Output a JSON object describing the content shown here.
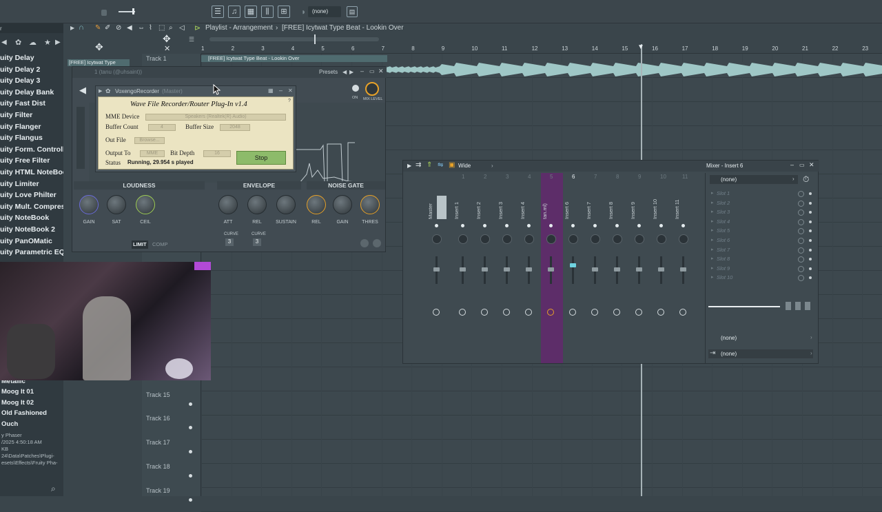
{
  "toolbar": {
    "pattern_selector": "(none)"
  },
  "browser": {
    "items": [
      "uity Delay",
      "uity Delay 2",
      "uity Delay 3",
      "uity Delay Bank",
      "uity Fast Dist",
      "uity Filter",
      "uity Flanger",
      "uity Flangus",
      "uity Form. Controller",
      "uity Free Filter",
      "uity HTML NoteBook",
      "uity Limiter",
      "uity Love Philter",
      "uity Mult. Compressor",
      "uity NoteBook",
      "uity NoteBook 2",
      "uity PanOMatic",
      "uity Parametric EQ"
    ],
    "lower_items": [
      "Metallic",
      "Moog It 01",
      "Moog It 02",
      "Old Fashioned",
      "Ouch"
    ],
    "info": {
      "name": "y Phaser",
      "date": "/2025 4:50:18 AM",
      "size": "KB",
      "path1": "24\\Data\\Patches\\Plugi-",
      "path2": "esets\\Effects\\Fruity Pha-"
    }
  },
  "playlist": {
    "title": "Playlist - Arrangement",
    "breadcrumb": "[FREE] Icytwat Type Beat - Lookin Over",
    "clip_name": "[FREE] Icytwat Type Beat - Lookin Over",
    "clip_label_left": "[FREE] Icytwat Type",
    "ruler": [
      "1",
      "2",
      "3",
      "4",
      "5",
      "6",
      "7",
      "8",
      "9",
      "10",
      "11",
      "12",
      "13",
      "14",
      "15",
      "16",
      "17",
      "18",
      "19",
      "20",
      "21",
      "22",
      "23"
    ],
    "tracks": [
      {
        "label": "Track 1"
      },
      {
        "label": "Track 15"
      },
      {
        "label": "Track 16"
      },
      {
        "label": "Track 17"
      },
      {
        "label": "Track 18"
      },
      {
        "label": "Track 19"
      }
    ]
  },
  "plugin": {
    "window_title": "1 (tanu (@uhsaint))",
    "presets_label": "Presets",
    "recorder_title": "VoxengoRecorder",
    "recorder_host": "(Master)",
    "panel_title": "Wave File Recorder/Router Plug-In v1.4",
    "mme_device_label": "MME Device",
    "mme_device_value": "Speakers (Realtek(R) Audio)",
    "buffer_count_label": "Buffer Count",
    "buffer_count_value": "4",
    "buffer_size_label": "Buffer Size",
    "buffer_size_value": "2048",
    "out_file_label": "Out File",
    "browse_label": "Browse...",
    "output_to_label": "Output To",
    "output_to_value": "MME",
    "bit_depth_label": "Bit Depth",
    "bit_depth_value": "16",
    "status_label": "Status",
    "status_value": "Running, 29.954 s played",
    "stop_label": "Stop",
    "on_label": "ON",
    "mix_level_label": "MIX LEVEL",
    "sections": [
      "LOUDNESS",
      "ENVELOPE",
      "NOISE GATE"
    ],
    "knobs": [
      "GAIN",
      "SAT",
      "CEIL",
      "ATT",
      "REL",
      "SUSTAIN",
      "REL",
      "GAIN",
      "THRES"
    ],
    "curve_label": "CURVE",
    "curve_values": [
      "3",
      "3"
    ],
    "mode_tabs": [
      "LIMIT",
      "COMP"
    ]
  },
  "mixer": {
    "title": "Wide",
    "insert_title": "Mixer - Insert 6",
    "strips": [
      "Master",
      "Insert 1",
      "Insert 2",
      "Insert 3",
      "Insert 4",
      "tan.ml)",
      "Insert 6",
      "Insert 7",
      "Insert 8",
      "Insert 9",
      "Insert 10",
      "Insert 11"
    ],
    "column_numbers": [
      "1",
      "2",
      "3",
      "4",
      "5",
      "6",
      "7",
      "8",
      "9",
      "10",
      "11"
    ],
    "slots": [
      "Slot 1",
      "Slot 2",
      "Slot 3",
      "Slot 4",
      "Slot 5",
      "Slot 6",
      "Slot 7",
      "Slot 8",
      "Slot 9",
      "Slot 10"
    ],
    "input": "(none)",
    "output_top": "(none)",
    "output_bottom": "(none)"
  },
  "colors": {
    "accent_green": "#9fce54",
    "accent_orange": "#e8a228",
    "selected_strip": "#7a2c8a",
    "waveform": "#9fc7c6"
  }
}
